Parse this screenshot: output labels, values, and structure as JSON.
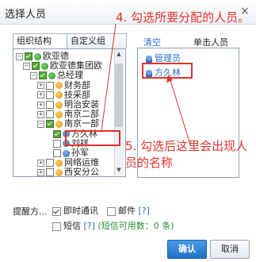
{
  "dialog": {
    "title": "选择人员",
    "close": "×"
  },
  "tabs": [
    {
      "label": "组织结构",
      "active": true
    },
    {
      "label": "自定义组",
      "active": false
    }
  ],
  "tree": [
    {
      "label": "欧亚德",
      "level": 0,
      "toggle": "−",
      "checked": true,
      "icon": "org"
    },
    {
      "label": "欧亚德集团欧",
      "level": 1,
      "toggle": "−",
      "checked": true,
      "icon": "org"
    },
    {
      "label": "总经理",
      "level": 2,
      "toggle": "−",
      "checked": true,
      "icon": "org"
    },
    {
      "label": "财务部",
      "level": 3,
      "toggle": "+",
      "checked": false,
      "icon": "dept"
    },
    {
      "label": "技采部",
      "level": 3,
      "toggle": "+",
      "checked": false,
      "icon": "dept"
    },
    {
      "label": "明治安装",
      "level": 3,
      "toggle": "+",
      "checked": false,
      "icon": "dept"
    },
    {
      "label": "南京二部",
      "level": 3,
      "toggle": "+",
      "checked": false,
      "icon": "dept"
    },
    {
      "label": "南京一部",
      "level": 3,
      "toggle": "−",
      "checked": true,
      "icon": "dept"
    },
    {
      "label": "方久林",
      "level": 4,
      "toggle": "",
      "checked": true,
      "icon": "user"
    },
    {
      "label": "刘祥",
      "level": 4,
      "toggle": "",
      "checked": false,
      "icon": "user"
    },
    {
      "label": "孙军",
      "level": 4,
      "toggle": "",
      "checked": false,
      "icon": "user"
    },
    {
      "label": "网络运维",
      "level": 3,
      "toggle": "+",
      "checked": false,
      "icon": "dept"
    },
    {
      "label": "西安分公",
      "level": 3,
      "toggle": "+",
      "checked": false,
      "icon": "dept"
    }
  ],
  "right_panel": {
    "clear_label": "清空",
    "hint": "单击人员",
    "items": [
      "管理员",
      "方久林"
    ]
  },
  "annotations": {
    "step4": "4. 勾选所要分配的人员。",
    "step5": "5. 勾选后这里会出现人员的名称"
  },
  "options": {
    "remind_label": "提醒方...",
    "instant": "即时通讯",
    "mail": "邮件",
    "mail_help": "[?]",
    "sms": "短信",
    "sms_help": "[?]",
    "sms_quota": "(短信可用数：0 条)"
  },
  "buttons": {
    "ok": "确认",
    "cancel": "取消"
  },
  "colors": {
    "annotation": "#e0342b",
    "primary": "#1f6fc4",
    "link": "#2a6fc9"
  }
}
